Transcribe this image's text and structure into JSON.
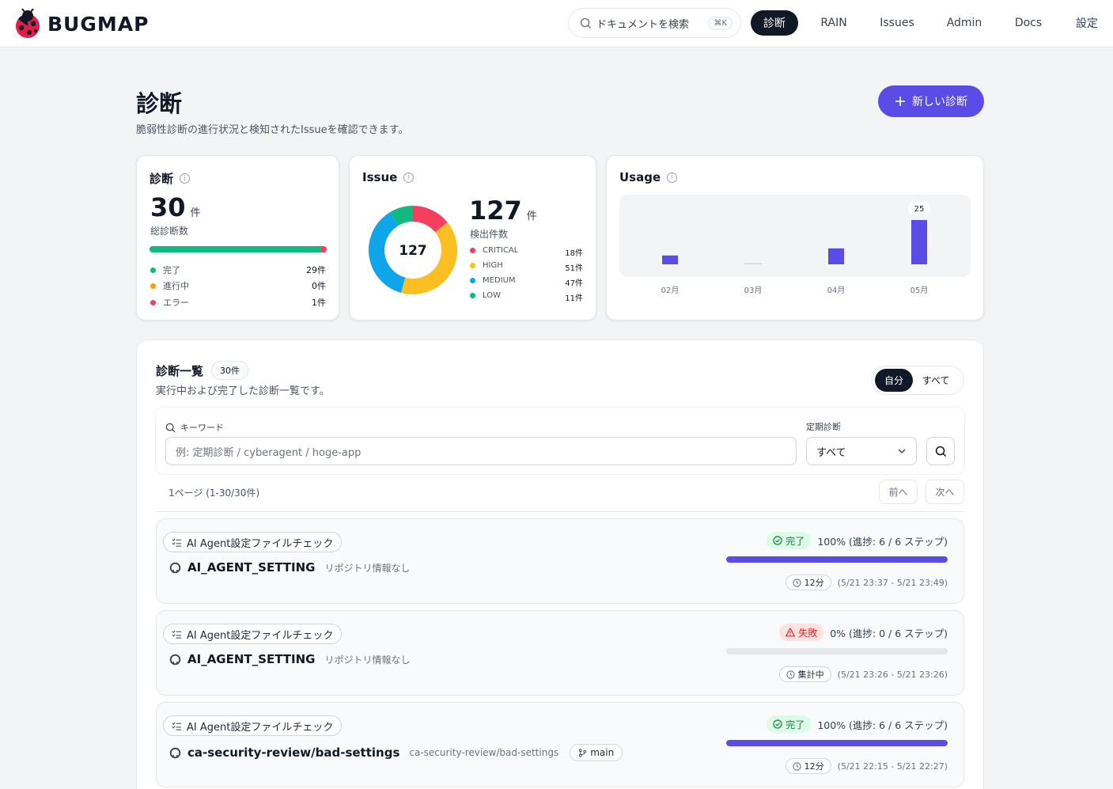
{
  "header": {
    "logo_text": "BUGMAP",
    "search_placeholder": "ドキュメントを検索",
    "search_shortcut": "⌘K",
    "nav": [
      "診断",
      "RAIN",
      "Issues",
      "Admin",
      "Docs",
      "設定"
    ]
  },
  "page": {
    "title": "診断",
    "subtitle": "脆弱性診断の進行状況と検知されたIssueを確認できます。",
    "new_button": "新しい診断"
  },
  "diag_card": {
    "title": "診断",
    "total": "30",
    "unit": "件",
    "total_label": "総診断数",
    "completed_fraction": 0.967,
    "colors": {
      "done": "#10b981",
      "running": "#f59e0b",
      "error": "#f43f5e"
    },
    "legend": [
      {
        "label": "完了",
        "value": "29件"
      },
      {
        "label": "進行中",
        "value": "0件"
      },
      {
        "label": "エラー",
        "value": "1件"
      }
    ]
  },
  "issue_card": {
    "title": "Issue",
    "center": "127",
    "total": "127",
    "unit": "件",
    "total_label": "検出件数",
    "legend": [
      {
        "label": "CRITICAL",
        "value": "18件",
        "count": 18,
        "color": "#f43f5e"
      },
      {
        "label": "HIGH",
        "value": "51件",
        "count": 51,
        "color": "#fbbf24"
      },
      {
        "label": "MEDIUM",
        "value": "47件",
        "count": 47,
        "color": "#0ea5e9"
      },
      {
        "label": "LOW",
        "value": "11件",
        "count": 11,
        "color": "#10b981"
      }
    ]
  },
  "usage_card": {
    "title": "Usage",
    "chart_data": {
      "type": "bar",
      "categories": [
        "02月",
        "03月",
        "04月",
        "05月"
      ],
      "values": [
        5,
        0,
        9,
        25
      ],
      "ylim": [
        0,
        25
      ],
      "data_labels": [
        "",
        "",
        "",
        "25"
      ]
    }
  },
  "list": {
    "title": "診断一覧",
    "count_badge": "30件",
    "subtitle": "実行中および完了した診断一覧です。",
    "toggle": [
      "自分",
      "すべて"
    ],
    "keyword_label": "キーワード",
    "keyword_placeholder": "例: 定期診断 / cyberagent / hoge-app",
    "periodic_label": "定期診断",
    "periodic_value": "すべて",
    "page_info": "1ページ (1-30/30件)",
    "prev": "前へ",
    "next": "次へ",
    "items": [
      {
        "tag": "AI Agent設定ファイルチェック",
        "repo": "AI_AGENT_SETTING",
        "repo_sub": "リポジトリ情報なし",
        "branch": "",
        "status": "完了",
        "status_type": "ok",
        "progress_text": "100% (進捗: 6 / 6 ステップ)",
        "progress": 1.0,
        "duration": "12分",
        "range": "(5/21 23:37 - 5/21 23:49)"
      },
      {
        "tag": "AI Agent設定ファイルチェック",
        "repo": "AI_AGENT_SETTING",
        "repo_sub": "リポジトリ情報なし",
        "branch": "",
        "status": "失敗",
        "status_type": "fail",
        "progress_text": "0% (進捗: 0 / 6 ステップ)",
        "progress": 0.0,
        "duration": "集計中",
        "range": "(5/21 23:26 - 5/21 23:26)"
      },
      {
        "tag": "AI Agent設定ファイルチェック",
        "repo": "ca-security-review/bad-settings",
        "repo_sub": "ca-security-review/bad-settings",
        "branch": "main",
        "status": "完了",
        "status_type": "ok",
        "progress_text": "100% (進捗: 6 / 6 ステップ)",
        "progress": 1.0,
        "duration": "12分",
        "range": "(5/21 22:15 - 5/21 22:27)"
      }
    ]
  }
}
